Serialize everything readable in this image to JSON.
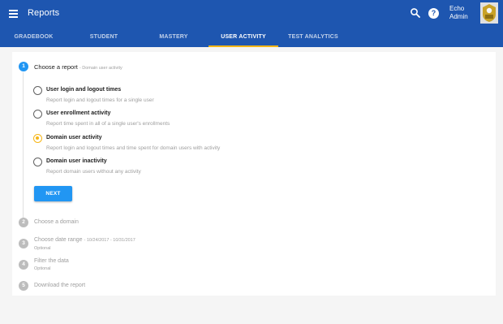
{
  "header": {
    "title": "Reports",
    "user_name": "Echo Admin",
    "menu_icon": "hamburger-menu-icon",
    "search_icon": "search-icon",
    "help_icon": "help-icon",
    "help_glyph": "?",
    "brand_color": "#1e56b0",
    "accent_color": "#f6b617"
  },
  "tabs": [
    {
      "label": "GRADEBOOK",
      "active": false
    },
    {
      "label": "STUDENT",
      "active": false
    },
    {
      "label": "MASTERY",
      "active": false
    },
    {
      "label": "USER ACTIVITY",
      "active": true
    },
    {
      "label": "TEST ANALYTICS",
      "active": false
    }
  ],
  "steps": [
    {
      "number": "1",
      "title": "Choose a report",
      "subtitle": "- Domain user activity",
      "optional": ""
    },
    {
      "number": "2",
      "title": "Choose a domain",
      "subtitle": "",
      "optional": ""
    },
    {
      "number": "3",
      "title": "Choose date range",
      "subtitle": "- 10/24/2017 - 10/31/2017",
      "optional": "Optional"
    },
    {
      "number": "4",
      "title": "Filter the data",
      "subtitle": "",
      "optional": "Optional"
    },
    {
      "number": "5",
      "title": "Download the report",
      "subtitle": "",
      "optional": ""
    }
  ],
  "report_options": [
    {
      "label": "User login and logout times",
      "description": "Report login and logout times for a single user",
      "selected": false
    },
    {
      "label": "User enrollment activity",
      "description": "Report time spent in all of a single user's enrollments",
      "selected": false
    },
    {
      "label": "Domain user activity",
      "description": "Report login and logout times and time spent for domain users with activity",
      "selected": true
    },
    {
      "label": "Domain user inactivity",
      "description": "Report domain users without any activity",
      "selected": false
    }
  ],
  "next_button": {
    "label": "NEXT",
    "color": "#2196f3"
  }
}
